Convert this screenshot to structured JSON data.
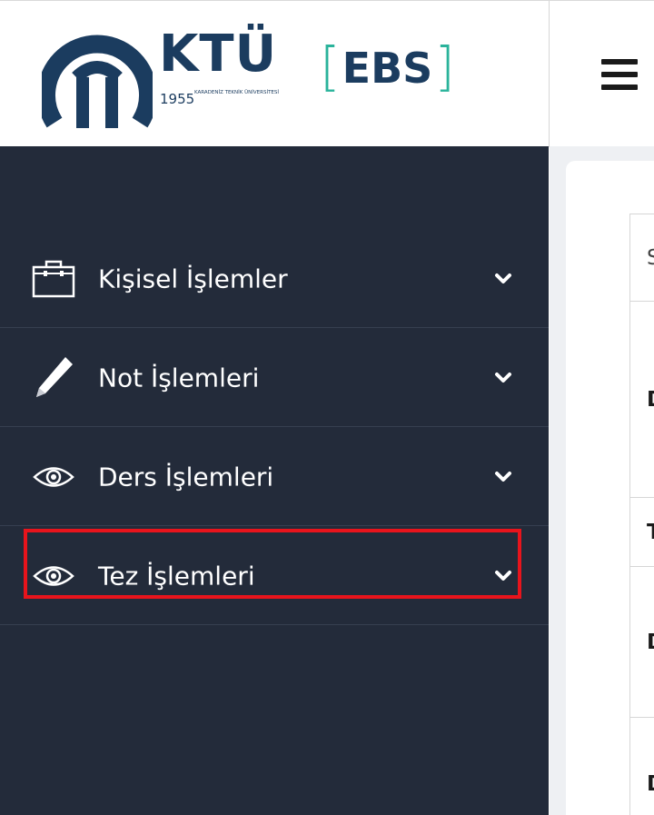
{
  "brand": {
    "name": "KTÜ",
    "year": "1955",
    "subtitle": "KARADENİZ TEKNİK ÜNİVERSİTESİ",
    "app": "EBS",
    "bracket_open": "[",
    "bracket_close": "]",
    "colors": {
      "navy": "#1b3c5f",
      "teal": "#2ab39b"
    }
  },
  "header": {
    "menu_toggle_icon": "hamburger-icon"
  },
  "sidebar": {
    "items": [
      {
        "label": "Kişisel İşlemler",
        "icon": "briefcase-icon"
      },
      {
        "label": "Not İşlemleri",
        "icon": "pencil-icon"
      },
      {
        "label": "Ders İşlemleri",
        "icon": "eye-icon"
      },
      {
        "label": "Tez İşlemleri",
        "icon": "eye-icon",
        "highlighted": true
      }
    ],
    "highlight_color": "#e8141c"
  },
  "content": {
    "cells": [
      "Sü",
      "De",
      "Te",
      "De",
      "De"
    ]
  }
}
